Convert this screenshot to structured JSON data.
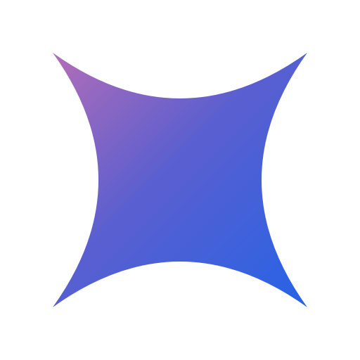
{
  "logo": {
    "icon": "curved-star-icon",
    "colors": {
      "gradient_start": "#B36DB8",
      "gradient_mid": "#5B5FCF",
      "gradient_end": "#2563E6"
    }
  }
}
